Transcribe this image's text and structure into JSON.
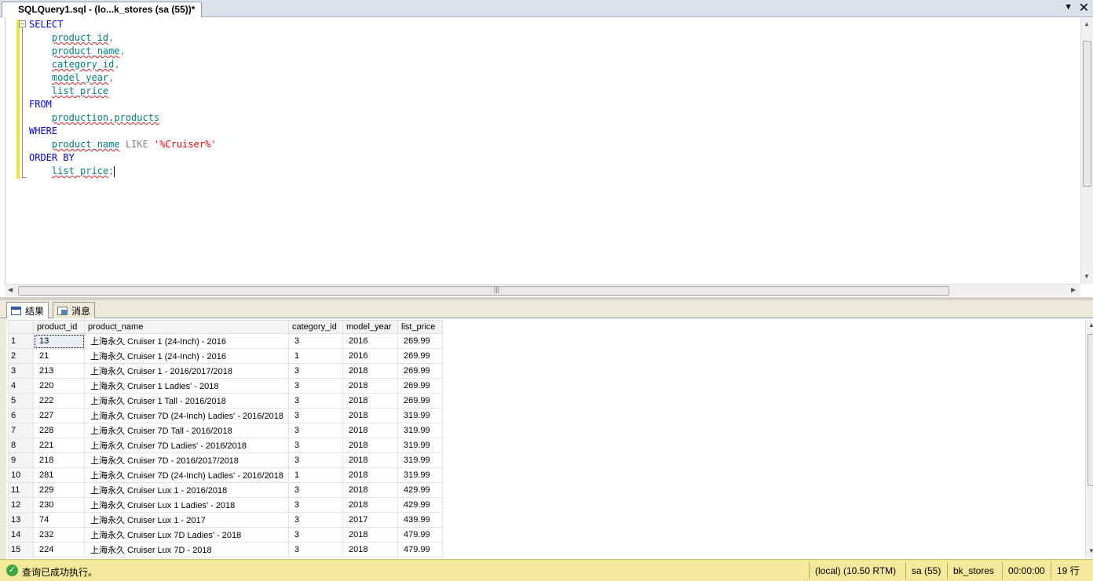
{
  "tab": {
    "title": "SQLQuery1.sql - (lo...k_stores (sa (55))*"
  },
  "editor": {
    "line1_select": "SELECT",
    "line2_col": "product_id",
    "line2_comma": ",",
    "line3_col": "product_name",
    "line3_comma": ",",
    "line4_col": "category_id",
    "line4_comma": ",",
    "line5_col": "model_year",
    "line5_comma": ",",
    "line6_col": "list_price",
    "line7_from": "FROM",
    "line8_table": "production.products",
    "line9_where": "WHERE",
    "line10_col": "product_name",
    "line10_like": "LIKE",
    "line10_str": "'%Cruiser%'",
    "line11_orderby": "ORDER BY",
    "line12_col": "list_price",
    "line12_semi": ";"
  },
  "results_tabs": {
    "results": "结果",
    "messages": "消息"
  },
  "grid": {
    "columns": [
      "",
      "product_id",
      "product_name",
      "category_id",
      "model_year",
      "list_price"
    ],
    "rows": [
      [
        "1",
        "13",
        "上海永久 Cruiser 1 (24-Inch) - 2016",
        "3",
        "2016",
        "269.99"
      ],
      [
        "2",
        "21",
        "上海永久 Cruiser 1 (24-Inch) - 2016",
        "1",
        "2016",
        "269.99"
      ],
      [
        "3",
        "213",
        "上海永久 Cruiser 1 - 2016/2017/2018",
        "3",
        "2018",
        "269.99"
      ],
      [
        "4",
        "220",
        "上海永久 Cruiser 1 Ladies' - 2018",
        "3",
        "2018",
        "269.99"
      ],
      [
        "5",
        "222",
        "上海永久 Cruiser 1 Tall - 2016/2018",
        "3",
        "2018",
        "269.99"
      ],
      [
        "6",
        "227",
        "上海永久 Cruiser 7D (24-Inch) Ladies' - 2016/2018",
        "3",
        "2018",
        "319.99"
      ],
      [
        "7",
        "228",
        "上海永久 Cruiser 7D Tall - 2016/2018",
        "3",
        "2018",
        "319.99"
      ],
      [
        "8",
        "221",
        "上海永久 Cruiser 7D Ladies' - 2016/2018",
        "3",
        "2018",
        "319.99"
      ],
      [
        "9",
        "218",
        "上海永久 Cruiser 7D - 2016/2017/2018",
        "3",
        "2018",
        "319.99"
      ],
      [
        "10",
        "281",
        "上海永久 Cruiser 7D (24-Inch) Ladies' - 2016/2018",
        "1",
        "2018",
        "319.99"
      ],
      [
        "11",
        "229",
        "上海永久 Cruiser Lux 1 - 2016/2018",
        "3",
        "2018",
        "429.99"
      ],
      [
        "12",
        "230",
        "上海永久 Cruiser Lux 1 Ladies' - 2018",
        "3",
        "2018",
        "429.99"
      ],
      [
        "13",
        "74",
        "上海永久 Cruiser Lux 1 - 2017",
        "3",
        "2017",
        "439.99"
      ],
      [
        "14",
        "232",
        "上海永久 Cruiser Lux 7D Ladies' - 2018",
        "3",
        "2018",
        "479.99"
      ],
      [
        "15",
        "224",
        "上海永久 Cruiser Lux 7D - 2018",
        "3",
        "2018",
        "479.99"
      ]
    ]
  },
  "status": {
    "message": "查询已成功执行。",
    "server": "(local) (10.50 RTM)",
    "user": "sa (55)",
    "database": "bk_stores",
    "elapsed": "00:00:00",
    "rows": "19 行"
  },
  "colors": {
    "status_bar": "#f4e89a",
    "keyword": "#0000ff",
    "identifier": "#008080",
    "string": "#ff0000"
  }
}
